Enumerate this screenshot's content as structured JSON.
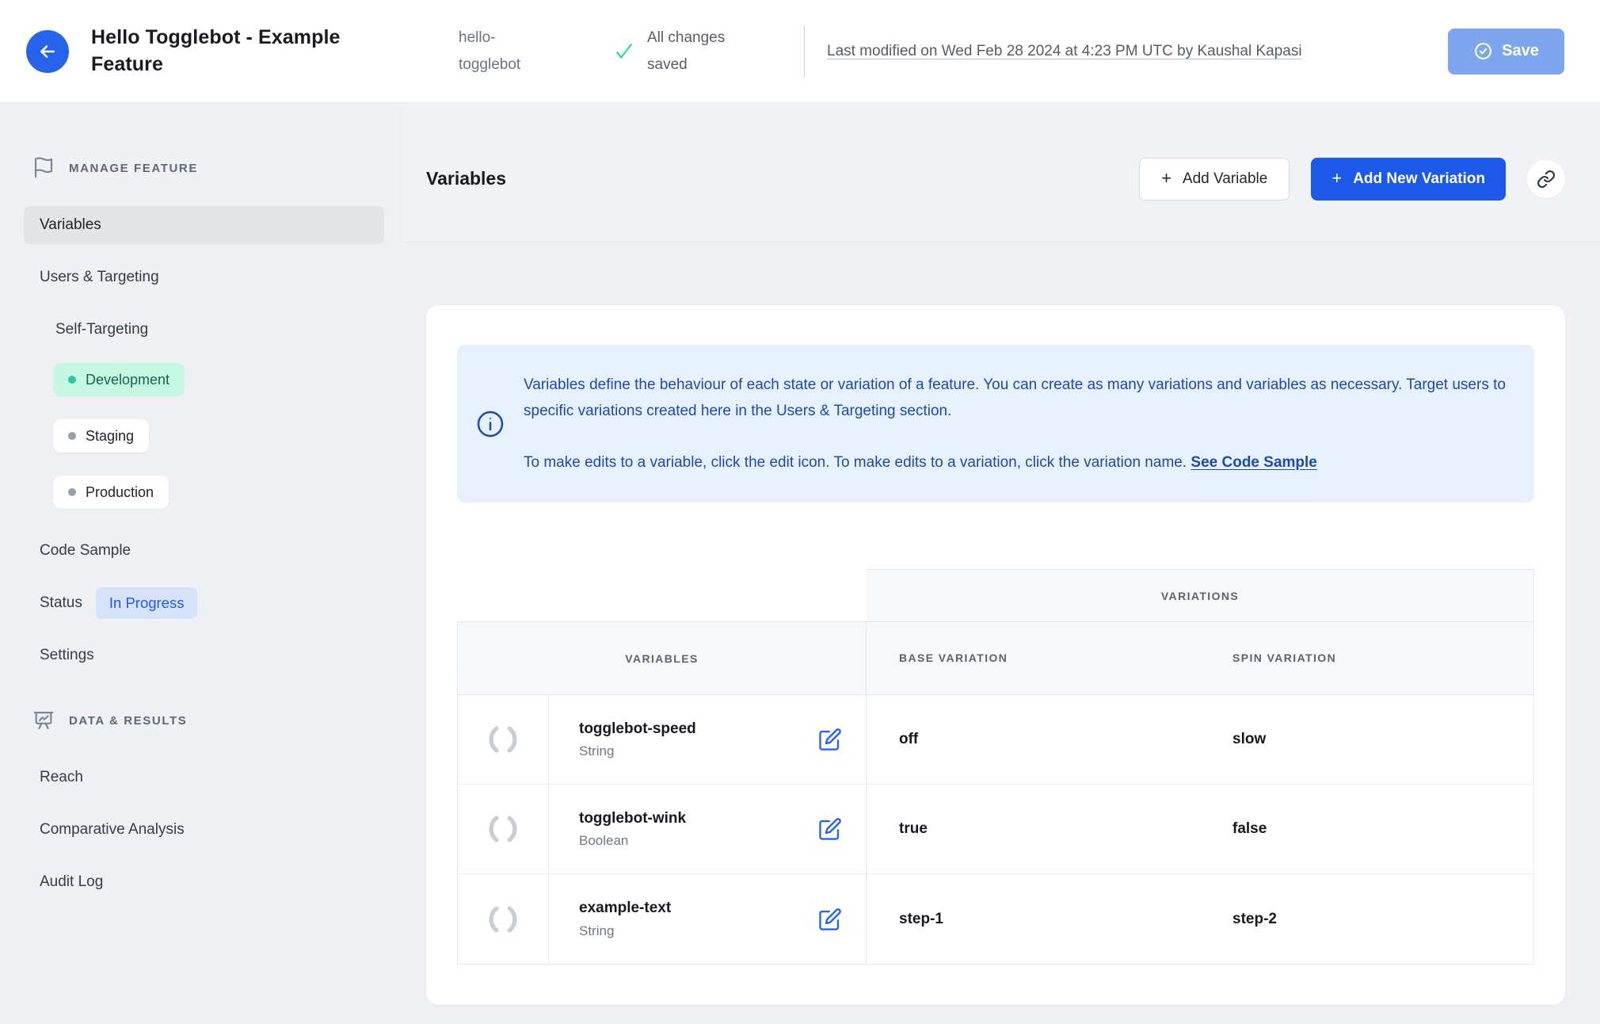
{
  "header": {
    "title": "Hello Togglebot - Example Feature",
    "feature_key": "hello-togglebot",
    "save_status": "All changes saved",
    "last_modified_link": "Last modified on Wed Feb 28 2024 at 4:23 PM UTC by Kaushal Kapasi",
    "save_button": "Save"
  },
  "sidebar": {
    "manage_section": {
      "label": "MANAGE FEATURE",
      "icon": "flag-icon"
    },
    "items": {
      "variables": "Variables",
      "users_targeting": "Users & Targeting",
      "self_targeting": "Self-Targeting",
      "code_sample": "Code Sample",
      "status": "Status",
      "settings": "Settings"
    },
    "status_badge": "In Progress",
    "environments": [
      {
        "label": "Development",
        "state": "active"
      },
      {
        "label": "Staging",
        "state": "inactive"
      },
      {
        "label": "Production",
        "state": "inactive"
      }
    ],
    "data_section": {
      "label": "DATA & RESULTS",
      "icon": "presentation-chart-icon"
    },
    "data_items": {
      "reach": "Reach",
      "comparative_analysis": "Comparative Analysis",
      "audit_log": "Audit Log"
    }
  },
  "toolbar": {
    "heading": "Variables",
    "add_variable_button": "Add Variable",
    "add_variation_button": "Add New Variation",
    "link_icon": "link-icon"
  },
  "info_box": {
    "paragraph1": "Variables define the behaviour of each state or variation of a feature. You can create as many variations and variables as necessary. Target users to specific variations created here in the Users & Targeting section.",
    "paragraph2": "To make edits to a variable, click the edit icon. To make edits to a variation, click the variation name.",
    "link": "See Code Sample"
  },
  "table": {
    "variations_header": "VARIATIONS",
    "columns": {
      "variables": "VARIABLES",
      "base": "BASE VARIATION",
      "spin": "SPIN VARIATION"
    },
    "rows": [
      {
        "name": "togglebot-speed",
        "type": "String",
        "base": "off",
        "spin": "slow"
      },
      {
        "name": "togglebot-wink",
        "type": "Boolean",
        "base": "true",
        "spin": "false"
      },
      {
        "name": "example-text",
        "type": "String",
        "base": "step-1",
        "spin": "step-2"
      }
    ]
  },
  "icons": {
    "plus": "+"
  },
  "colors": {
    "accent_blue": "#1c59e8",
    "save_disabled_blue": "#7ea6ee",
    "success_teal": "#34d2a8",
    "development_badge_bg": "#c5f7e2",
    "development_badge_text": "#176152",
    "in_progress_badge_bg": "#d5e2fa",
    "in_progress_badge_text": "#2257e7",
    "info_box_bg": "#e7f0fd",
    "info_text": "#1d4aa8",
    "edit_icon_blue": "#2563eb",
    "page_background": "#eef0f4"
  }
}
